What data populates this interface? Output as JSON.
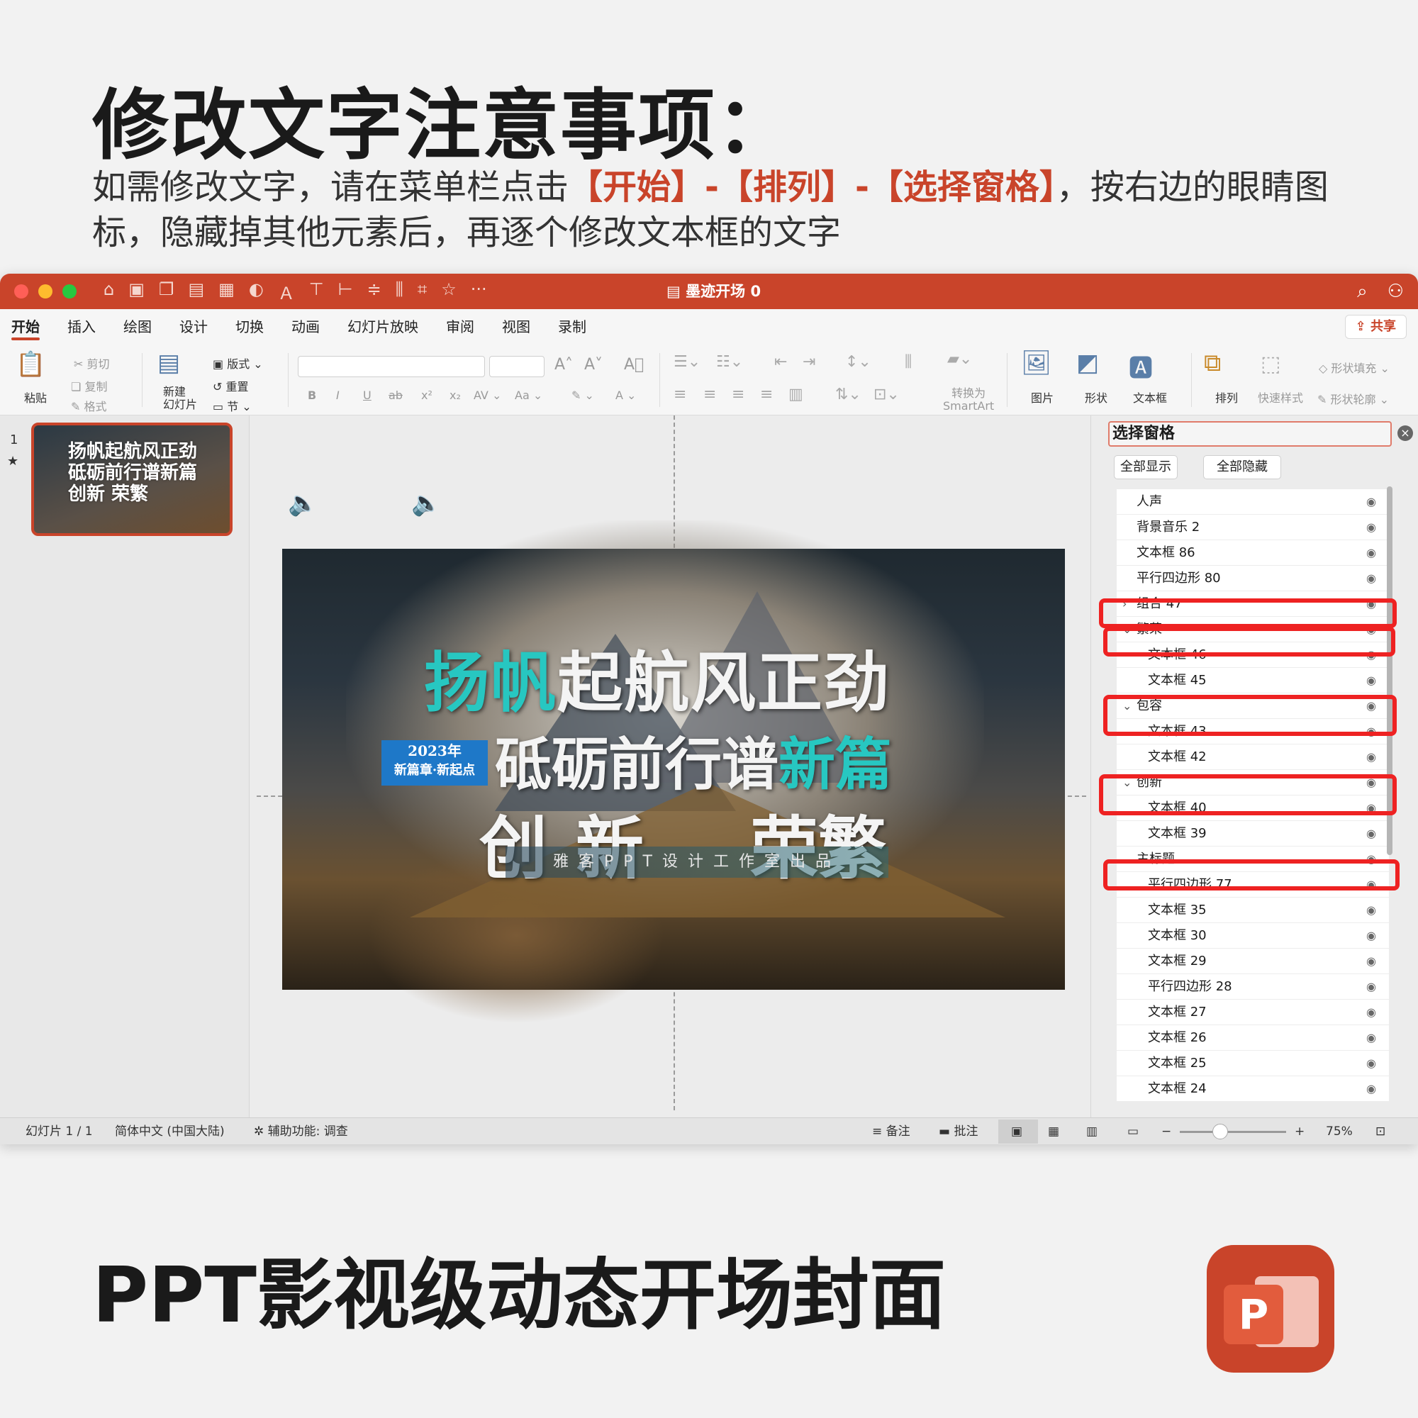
{
  "header": {
    "title": "修改文字注意事项：",
    "desc_pre": "如需修改文字，请在菜单栏点击",
    "desc_highlight": "【开始】-【排列】-【选择窗格】",
    "desc_post": "，按右边的眼睛图标，隐藏掉其他元素后，再逐个修改文本框的文字"
  },
  "window": {
    "doc_title": "墨迹开场 0",
    "tabs": [
      "开始",
      "插入",
      "绘图",
      "设计",
      "切换",
      "动画",
      "幻灯片放映",
      "审阅",
      "视图",
      "录制"
    ],
    "share_label": "共享",
    "ribbon": {
      "paste": "粘贴",
      "cut": "剪切",
      "copy": "复制",
      "format": "格式",
      "new_slide": "新建\n幻灯片",
      "layout": "版式",
      "reset": "重置",
      "section": "节",
      "convert_smartart": "转换为\nSmartArt",
      "picture": "图片",
      "shape": "形状",
      "textbox": "文本框",
      "arrange": "排列",
      "quick_styles": "快速样式",
      "shape_fill": "形状填充",
      "shape_outline": "形状轮廓"
    }
  },
  "thumbs": {
    "slide_number": "1",
    "star": "★",
    "thumb_text": "扬帆起航风正劲\n砥砺前行谱新篇\n创新 荣繁"
  },
  "slide": {
    "line1_teal": "扬帆",
    "line1_white": "起航风正劲",
    "line2_white": "砥砺前行谱",
    "line2_teal": "新篇",
    "line3_left": "创新",
    "line3_right": "荣繁",
    "badge_year": "2023年",
    "badge_sub": "新篇章·新起点",
    "credit": "雅客PPT设计工作室出品"
  },
  "pane": {
    "title": "选择窗格",
    "show_all": "全部显示",
    "hide_all": "全部隐藏",
    "items": [
      {
        "label": "人声",
        "level": 0,
        "chev": ""
      },
      {
        "label": "背景音乐 2",
        "level": 0,
        "chev": ""
      },
      {
        "label": "文本框 86",
        "level": 0,
        "chev": ""
      },
      {
        "label": "平行四边形 80",
        "level": 0,
        "chev": ""
      },
      {
        "label": "组合 47",
        "level": 0,
        "chev": "›"
      },
      {
        "label": "繁荣",
        "level": 0,
        "chev": "⌄"
      },
      {
        "label": "文本框 46",
        "level": 1,
        "chev": ""
      },
      {
        "label": "文本框 45",
        "level": 1,
        "chev": ""
      },
      {
        "label": "包容",
        "level": 0,
        "chev": "⌄"
      },
      {
        "label": "文本框 43",
        "level": 1,
        "chev": ""
      },
      {
        "label": "文本框 42",
        "level": 1,
        "chev": ""
      },
      {
        "label": "创新",
        "level": 0,
        "chev": "⌄"
      },
      {
        "label": "文本框 40",
        "level": 1,
        "chev": ""
      },
      {
        "label": "文本框 39",
        "level": 1,
        "chev": ""
      },
      {
        "label": "主标题",
        "level": 0,
        "chev": "⌄"
      },
      {
        "label": "平行四边形 77",
        "level": 1,
        "chev": ""
      },
      {
        "label": "文本框 35",
        "level": 1,
        "chev": ""
      },
      {
        "label": "文本框 30",
        "level": 1,
        "chev": ""
      },
      {
        "label": "文本框 29",
        "level": 1,
        "chev": ""
      },
      {
        "label": "平行四边形 28",
        "level": 1,
        "chev": ""
      },
      {
        "label": "文本框 27",
        "level": 1,
        "chev": ""
      },
      {
        "label": "文本框 26",
        "level": 1,
        "chev": ""
      },
      {
        "label": "文本框 25",
        "level": 1,
        "chev": ""
      },
      {
        "label": "文本框 24",
        "level": 1,
        "chev": ""
      }
    ],
    "eye_glyph": "◉"
  },
  "status": {
    "slide_count": "幻灯片 1 / 1",
    "language": "简体中文 (中国大陆)",
    "accessibility": "辅助功能: 调查",
    "notes": "备注",
    "comments": "批注",
    "zoom": "75%"
  },
  "footer": {
    "title": "PPT影视级动态开场封面",
    "logo_letter": "P"
  },
  "colors": {
    "accent": "#c9442a",
    "highlight_box": "#ee2222",
    "teal": "#27c7c1"
  }
}
